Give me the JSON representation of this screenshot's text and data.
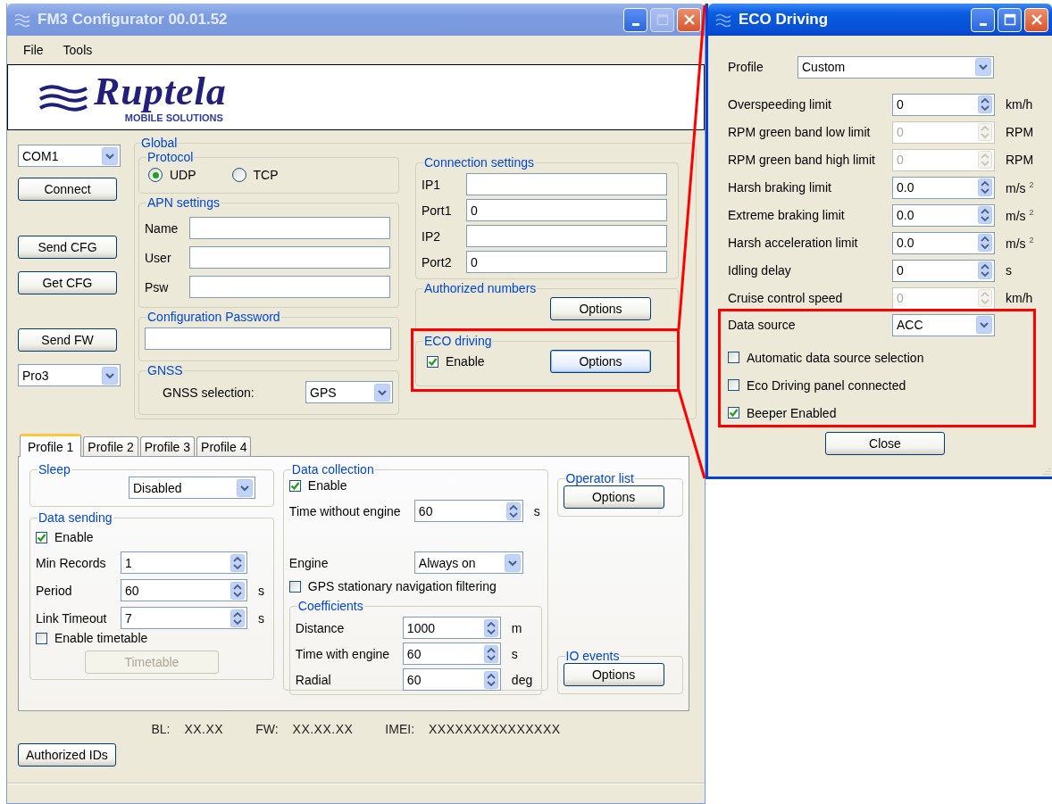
{
  "main_window": {
    "title": "FM3 Configurator 00.01.52",
    "maximize_enabled": false,
    "menu": [
      {
        "label": "File"
      },
      {
        "label": "Tools"
      }
    ],
    "logo": {
      "name": "Ruptela",
      "tagline": "MOBILE SOLUTIONS"
    },
    "connection_controls": [
      {
        "kind": "select",
        "value": "COM1"
      },
      {
        "kind": "button",
        "label": "Connect"
      },
      {
        "kind": "button",
        "label": "Send CFG"
      },
      {
        "kind": "button",
        "label": "Get CFG"
      },
      {
        "kind": "button",
        "label": "Send FW"
      },
      {
        "kind": "select",
        "value": "Pro3"
      }
    ],
    "global": {
      "title": "Global",
      "protocol": {
        "title": "Protocol",
        "options": [
          {
            "label": "UDP",
            "selected": true
          },
          {
            "label": "TCP",
            "selected": false
          }
        ]
      },
      "apn": {
        "title": "APN settings",
        "fields": [
          {
            "label": "Name"
          },
          {
            "label": "User"
          },
          {
            "label": "Psw"
          }
        ]
      },
      "config_password": {
        "title": "Configuration Password"
      },
      "gnss": {
        "title": "GNSS",
        "label": "GNSS selection:",
        "value": "GPS"
      },
      "connection": {
        "title": "Connection settings",
        "fields": [
          {
            "label": "IP1"
          },
          {
            "label": "Port1",
            "value": "0"
          },
          {
            "label": "IP2"
          },
          {
            "label": "Port2",
            "value": "0"
          }
        ]
      },
      "authorized_numbers": {
        "title": "Authorized numbers",
        "button": "Options"
      },
      "eco_driving": {
        "title": "ECO driving",
        "enable": {
          "label": "Enable",
          "checked": true
        },
        "button": "Options"
      }
    },
    "tabs": [
      {
        "label": "Profile 1",
        "selected": true
      },
      {
        "label": "Profile 2",
        "selected": false
      },
      {
        "label": "Profile 3",
        "selected": false
      },
      {
        "label": "Profile 4",
        "selected": false
      }
    ],
    "profile": {
      "sleep": {
        "title": "Sleep",
        "value": "Disabled"
      },
      "data_sending": {
        "title": "Data sending",
        "enable": {
          "label": "Enable",
          "checked": true
        },
        "fields": [
          {
            "label": "Min Records",
            "value": "1"
          },
          {
            "label": "Period",
            "value": "60",
            "unit": "s"
          },
          {
            "label": "Link Timeout",
            "value": "7",
            "unit": "s"
          }
        ],
        "timetable_check": {
          "label": "Enable timetable",
          "checked": false
        },
        "timetable_button": {
          "label": "Timetable",
          "disabled": true
        }
      },
      "data_collection": {
        "title": "Data collection",
        "enable": {
          "label": "Enable",
          "checked": true
        },
        "time_without_engine": {
          "label": "Time without engine",
          "value": "60",
          "unit": "s"
        },
        "engine": {
          "label": "Engine",
          "value": "Always on"
        },
        "gps_filter": {
          "label": "GPS stationary navigation filtering",
          "checked": false
        },
        "coefficients": {
          "title": "Coefficients",
          "fields": [
            {
              "label": "Distance",
              "value": "1000",
              "unit": "m"
            },
            {
              "label": "Time with engine",
              "value": "60",
              "unit": "s"
            },
            {
              "label": "Radial",
              "value": "60",
              "unit": "deg"
            }
          ]
        }
      },
      "operator_list": {
        "title": "Operator list",
        "button": "Options"
      },
      "io_events": {
        "title": "IO events",
        "button": "Options"
      }
    },
    "info": [
      {
        "label": "BL:",
        "value": "XX.XX"
      },
      {
        "label": "FW:",
        "value": "XX.XX.XX"
      },
      {
        "label": "IMEI:",
        "value": "XXXXXXXXXXXXXXX"
      }
    ],
    "authorized_ids_button": "Authorized IDs"
  },
  "eco_window": {
    "title": "ECO Driving",
    "profile": {
      "label": "Profile",
      "value": "Custom"
    },
    "rows": [
      {
        "label": "Overspeeding limit",
        "value": "0",
        "unit": "km/h",
        "disabled": false
      },
      {
        "label": "RPM green band low limit",
        "value": "0",
        "unit": "RPM",
        "disabled": true
      },
      {
        "label": "RPM green band high limit",
        "value": "0",
        "unit": "RPM",
        "disabled": true
      },
      {
        "label": "Harsh braking limit",
        "value": "0.0",
        "unit": "m/s $^{2}$",
        "disabled": false
      },
      {
        "label": "Extreme braking limit",
        "value": "0.0",
        "unit": "m/s $^{2}$",
        "disabled": false
      },
      {
        "label": "Harsh acceleration limit",
        "value": "0.0",
        "unit": "m/s $^{2}$",
        "disabled": false
      },
      {
        "label": "Idling delay",
        "value": "0",
        "unit": "s",
        "disabled": false
      },
      {
        "label": "Cruise control speed",
        "value": "0",
        "unit": "km/h",
        "disabled": true
      }
    ],
    "data_source": {
      "label": "Data source",
      "value": "ACC"
    },
    "options": [
      {
        "label": "Automatic data source selection",
        "checked": false
      },
      {
        "label": "Eco Driving panel connected",
        "checked": false
      },
      {
        "label": "Beeper Enabled",
        "checked": true
      }
    ],
    "close_button": "Close"
  }
}
